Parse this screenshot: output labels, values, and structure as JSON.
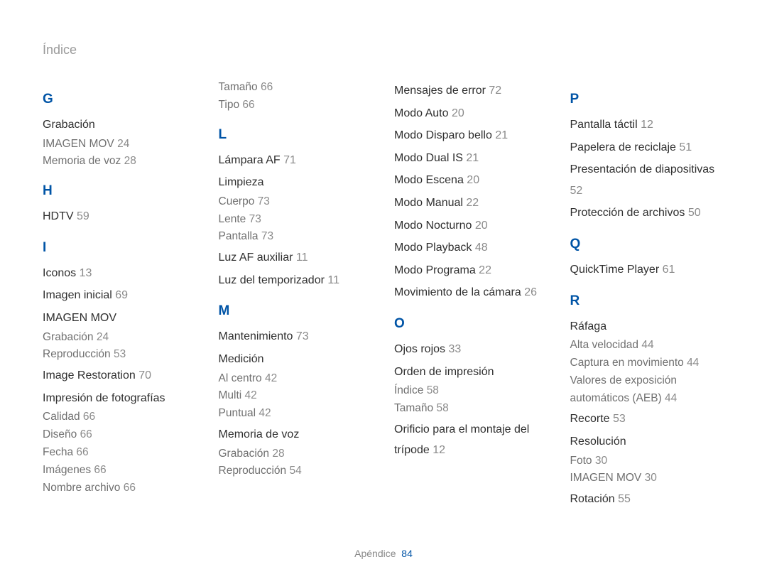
{
  "header": "Índice",
  "footer": {
    "text": "Apéndice",
    "page": "84"
  },
  "columns": [
    [
      {
        "type": "letter",
        "text": "G"
      },
      {
        "type": "entry",
        "text": "Grabación"
      },
      {
        "type": "sub",
        "text": "IMAGEN MOV",
        "page": "24"
      },
      {
        "type": "sub",
        "text": "Memoria de voz",
        "page": "28"
      },
      {
        "type": "letter",
        "text": "H"
      },
      {
        "type": "entry",
        "text": "HDTV",
        "page": "59"
      },
      {
        "type": "letter",
        "text": "I"
      },
      {
        "type": "entry",
        "text": "Iconos",
        "page": "13"
      },
      {
        "type": "entry",
        "text": "Imagen inicial",
        "page": "69"
      },
      {
        "type": "entry",
        "text": "IMAGEN MOV"
      },
      {
        "type": "sub",
        "text": "Grabación",
        "page": "24"
      },
      {
        "type": "sub",
        "text": "Reproducción",
        "page": "53"
      },
      {
        "type": "entry",
        "text": "Image Restoration",
        "page": "70"
      },
      {
        "type": "entry",
        "text": "Impresión de fotografías"
      },
      {
        "type": "sub",
        "text": "Calidad",
        "page": "66"
      },
      {
        "type": "sub",
        "text": "Diseño",
        "page": "66"
      },
      {
        "type": "sub",
        "text": "Fecha",
        "page": "66"
      },
      {
        "type": "sub",
        "text": "Imágenes",
        "page": "66"
      },
      {
        "type": "sub",
        "text": "Nombre archivo",
        "page": "66"
      }
    ],
    [
      {
        "type": "sub",
        "text": "Tamaño",
        "page": "66"
      },
      {
        "type": "sub",
        "text": "Tipo",
        "page": "66"
      },
      {
        "type": "letter",
        "text": "L"
      },
      {
        "type": "entry",
        "text": "Lámpara AF",
        "page": "71"
      },
      {
        "type": "entry",
        "text": "Limpieza"
      },
      {
        "type": "sub",
        "text": "Cuerpo",
        "page": "73"
      },
      {
        "type": "sub",
        "text": "Lente",
        "page": "73"
      },
      {
        "type": "sub",
        "text": "Pantalla",
        "page": "73"
      },
      {
        "type": "entry",
        "text": "Luz AF auxiliar",
        "page": "11"
      },
      {
        "type": "entry",
        "text": "Luz del temporizador",
        "page": "11"
      },
      {
        "type": "letter",
        "text": "M"
      },
      {
        "type": "entry",
        "text": "Mantenimiento",
        "page": "73"
      },
      {
        "type": "entry",
        "text": "Medición"
      },
      {
        "type": "sub",
        "text": "Al centro",
        "page": "42"
      },
      {
        "type": "sub",
        "text": "Multi",
        "page": "42"
      },
      {
        "type": "sub",
        "text": "Puntual",
        "page": "42"
      },
      {
        "type": "entry",
        "text": "Memoria de voz"
      },
      {
        "type": "sub",
        "text": "Grabación",
        "page": "28"
      },
      {
        "type": "sub",
        "text": "Reproducción",
        "page": "54"
      }
    ],
    [
      {
        "type": "entry",
        "text": "Mensajes de error",
        "page": "72"
      },
      {
        "type": "entry",
        "text": "Modo Auto",
        "page": "20"
      },
      {
        "type": "entry",
        "text": "Modo Disparo bello",
        "page": "21"
      },
      {
        "type": "entry",
        "text": "Modo Dual IS",
        "page": "21"
      },
      {
        "type": "entry",
        "text": "Modo Escena",
        "page": "20"
      },
      {
        "type": "entry",
        "text": "Modo Manual",
        "page": "22"
      },
      {
        "type": "entry",
        "text": "Modo Nocturno",
        "page": "20"
      },
      {
        "type": "entry",
        "text": "Modo Playback",
        "page": "48"
      },
      {
        "type": "entry",
        "text": "Modo Programa",
        "page": "22"
      },
      {
        "type": "entry",
        "text": "Movimiento de la cámara",
        "page": "26"
      },
      {
        "type": "letter",
        "text": "O"
      },
      {
        "type": "entry",
        "text": "Ojos rojos",
        "page": "33"
      },
      {
        "type": "entry",
        "text": "Orden de impresión"
      },
      {
        "type": "sub",
        "text": "Índice",
        "page": "58"
      },
      {
        "type": "sub",
        "text": "Tamaño",
        "page": "58"
      },
      {
        "type": "entry",
        "text": "Orificio para el montaje del trípode",
        "page": "12"
      }
    ],
    [
      {
        "type": "letter",
        "text": "P"
      },
      {
        "type": "entry",
        "text": "Pantalla táctil",
        "page": "12"
      },
      {
        "type": "entry",
        "text": "Papelera de reciclaje",
        "page": "51"
      },
      {
        "type": "entry",
        "text": "Presentación de diapositivas",
        "page": "52"
      },
      {
        "type": "entry",
        "text": "Protección de archivos",
        "page": "50"
      },
      {
        "type": "letter",
        "text": "Q"
      },
      {
        "type": "entry",
        "text": "QuickTime Player",
        "page": "61"
      },
      {
        "type": "letter",
        "text": "R"
      },
      {
        "type": "entry",
        "text": "Ráfaga"
      },
      {
        "type": "sub",
        "text": "Alta velocidad",
        "page": "44"
      },
      {
        "type": "sub",
        "text": "Captura en movimiento",
        "page": "44"
      },
      {
        "type": "sub",
        "text": "Valores de exposición automáticos (AEB)",
        "page": "44"
      },
      {
        "type": "entry",
        "text": "Recorte",
        "page": "53"
      },
      {
        "type": "entry",
        "text": "Resolución"
      },
      {
        "type": "sub",
        "text": "Foto",
        "page": "30"
      },
      {
        "type": "sub",
        "text": "IMAGEN MOV",
        "page": "30"
      },
      {
        "type": "entry",
        "text": "Rotación",
        "page": "55"
      }
    ]
  ]
}
